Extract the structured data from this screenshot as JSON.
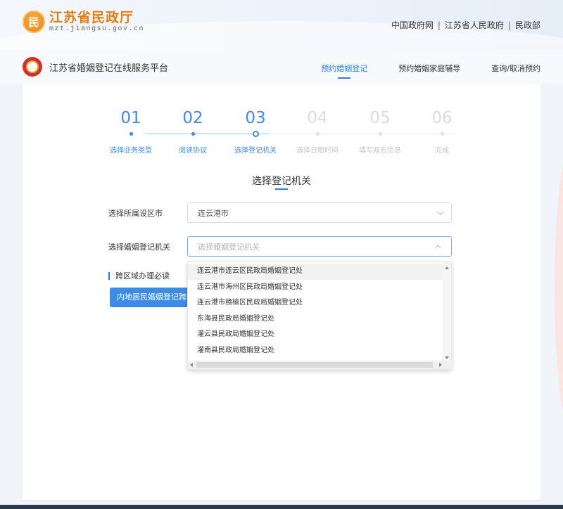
{
  "site": {
    "title": "江苏省民政厅",
    "domain": "mzt.jiangsu.gov.cn",
    "emblem_char": "民",
    "links": [
      "中国政府网",
      "江苏省人民政府",
      "民政部"
    ],
    "link_separator": "|"
  },
  "platform": {
    "name": "江苏省婚姻登记在线服务平台",
    "nav": [
      {
        "label": "预约婚姻登记",
        "active": true
      },
      {
        "label": "预约婚姻家庭辅导",
        "active": false
      },
      {
        "label": "查询/取消预约",
        "active": false
      }
    ]
  },
  "steps": [
    {
      "num": "01",
      "label": "选择业务类型",
      "status": "done"
    },
    {
      "num": "02",
      "label": "阅读协议",
      "status": "done"
    },
    {
      "num": "03",
      "label": "选择登记机关",
      "status": "current"
    },
    {
      "num": "04",
      "label": "选择日期时间",
      "status": "todo"
    },
    {
      "num": "05",
      "label": "填写双方信息",
      "status": "todo"
    },
    {
      "num": "06",
      "label": "完成",
      "status": "todo"
    }
  ],
  "form": {
    "section_title": "选择登记机关",
    "city_label": "选择所属设区市",
    "city_value": "连云港市",
    "office_label": "选择婚姻登记机关",
    "office_placeholder": "选择婚姻登记机关",
    "cross_region_note": "跨区域办理必读",
    "cross_region_button": "内地居民婚姻登记跨区域办理"
  },
  "dropdown": {
    "options": [
      "连云港市连云区民政局婚姻登记处",
      "连云港市海州区民政局婚姻登记处",
      "连云港市赣榆区民政局婚姻登记处",
      "东海县民政局婚姻登记处",
      "灌云县民政局婚姻登记处",
      "灌南县民政局婚姻登记处"
    ],
    "hover_index": 0
  },
  "colors": {
    "accent": "#3c8be6",
    "brand_orange": "#e47e14",
    "platform_red": "#d0312d"
  }
}
